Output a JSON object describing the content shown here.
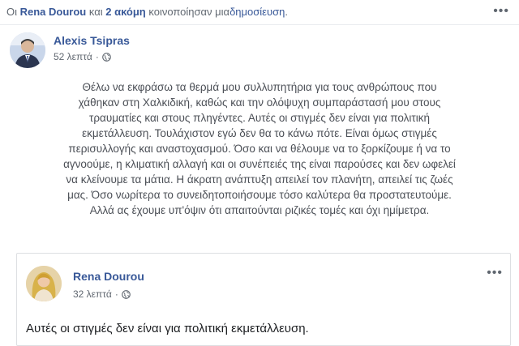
{
  "share_header": {
    "prefix": "Οι",
    "user1": "Rena Dourou",
    "conj": "και",
    "others": "2 ακόμη",
    "verb": "κοινοποίησαν μια",
    "object": "δημοσίευση",
    "suffix": "."
  },
  "more_icon": "more-dots-icon",
  "post": {
    "author": "Alexis Tsipras",
    "time": "52 λεπτά",
    "privacy_icon": "globe-icon",
    "lines": [
      "Θέλω να εκφράσω τα θερμά μου συλλυπητήρια για τους ανθρώπους που",
      "χάθηκαν στη Χαλκιδική, καθώς και την ολόψυχη συμπαράστασή μου στους",
      "τραυματίες και στους πληγέντες. Αυτές οι στιγμές δεν είναι για πολιτική",
      "εκμετάλλευση. Τουλάχιστον εγώ δεν θα το κάνω πότε. Είναι όμως στιγμές",
      "περισυλλογής και αναστοχασμού. Όσο και να θέλουμε να το ξορκίζουμε ή να το",
      "αγνοούμε, η κλιματική αλλαγή και οι συνέπειές της είναι παρούσες και δεν ωφελεί",
      "να κλείνουμε τα μάτια. Η άκρατη ανάπτυξη απειλεί τον πλανήτη, απειλεί τις ζωές",
      "μας. Όσο νωρίτερα το συνειδητοποιήσουμε τόσο καλύτερα θα προστατευτούμε.",
      "Αλλά ας έχουμε υπ'όψιν ότι απαιτούνται ριζικές τομές και όχι ημίμετρα."
    ]
  },
  "shared_post": {
    "author": "Rena Dourou",
    "time": "32 λεπτά",
    "privacy_icon": "globe-icon",
    "text": "Αυτές οι στιγμές δεν είναι για πολιτική εκμετάλλευση."
  }
}
